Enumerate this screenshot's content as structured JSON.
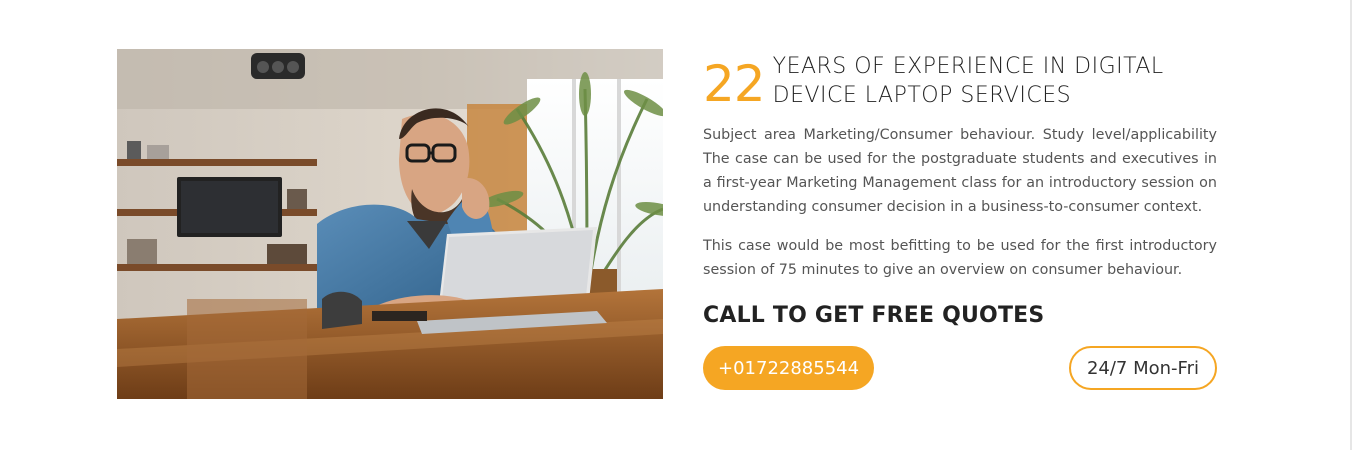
{
  "experience": {
    "years": "22",
    "line1": "YEARS OF EXPERIENCE IN DIGITAL",
    "line2": "DEVICE LAPTOP SERVICES"
  },
  "paragraphs": {
    "p1": "Subject area Marketing/Consumer behaviour. Study level/applicability The case can be used for the postgraduate students and executives in a first-year Marketing Management class for an introductory session on understanding consumer decision in a business-to-consumer context.",
    "p2": "This case would be most befitting to be used for the first introductory session of 75 minutes to give an overview on consumer behaviour."
  },
  "cta": {
    "title": "CALL TO GET FREE QUOTES",
    "phone_label": "+01722885544",
    "hours_label": "24/7 Mon-Fri"
  },
  "colors": {
    "accent": "#f5a623",
    "heading": "#222222",
    "body_text": "#555555"
  },
  "image": {
    "subject": "man-with-glasses-using-laptop-at-wooden-table"
  }
}
